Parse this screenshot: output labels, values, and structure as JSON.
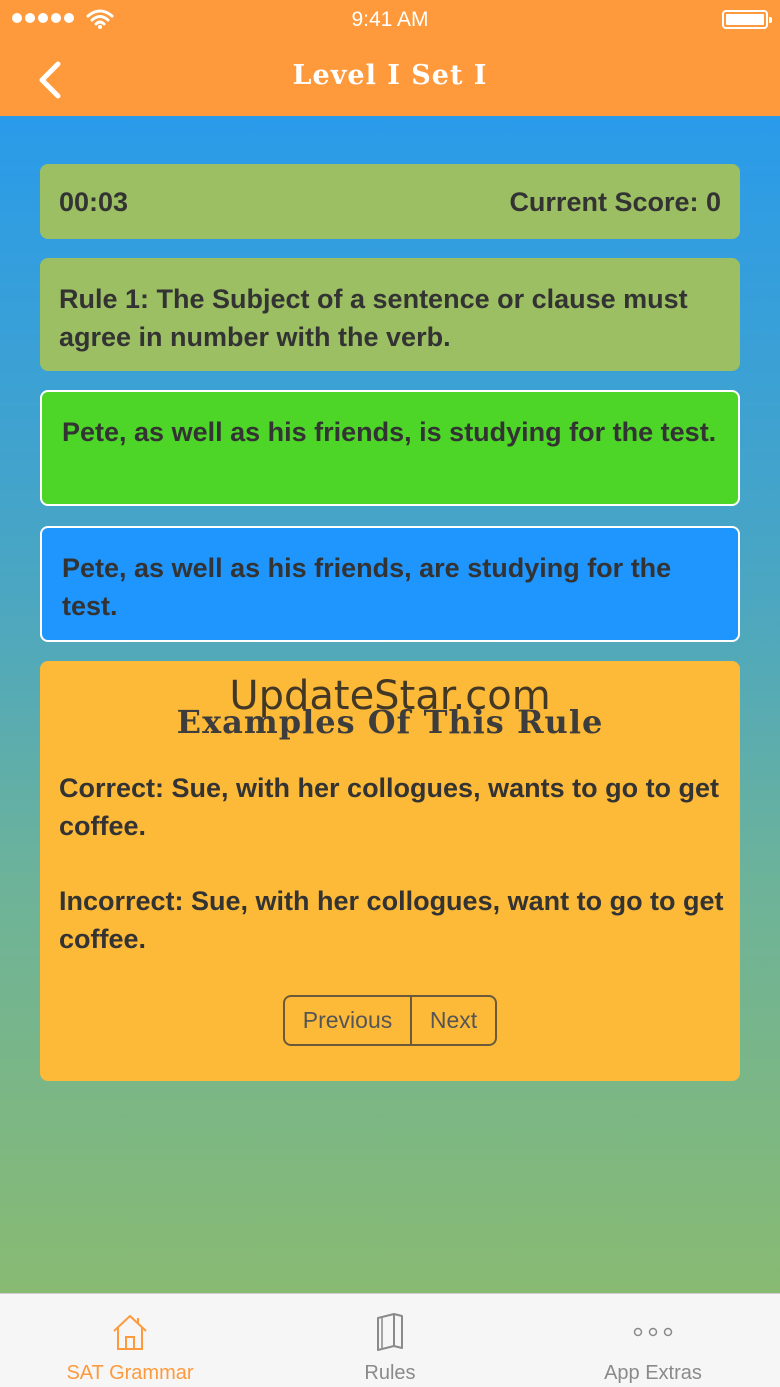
{
  "status_bar": {
    "time": "9:41 AM"
  },
  "header": {
    "title": "Level I Set I",
    "back_icon": "chevron-left-icon"
  },
  "quiz": {
    "timer": "00:03",
    "score_label": "Current Score: 0",
    "rule": "Rule 1: The Subject of a sentence or clause must agree in number with the verb.",
    "options": [
      "Pete, as well as his friends, is studying for the test.",
      "Pete, as well as his friends, are studying for the test."
    ]
  },
  "examples": {
    "watermark": "UpdateStar.com",
    "title": "Examples Of This Rule",
    "correct": "Correct: Sue, with her collogues, wants to go to get coffee.",
    "incorrect": "Incorrect: Sue, with her collogues, want to go to get coffee.",
    "previous_label": "Previous",
    "next_label": "Next"
  },
  "tabbar": {
    "items": [
      {
        "label": "SAT Grammar",
        "icon": "home-icon",
        "active": true
      },
      {
        "label": "Rules",
        "icon": "book-icon",
        "active": false
      },
      {
        "label": "App Extras",
        "icon": "more-icon",
        "active": false
      }
    ]
  },
  "colors": {
    "header": "#FE9A3C",
    "card_green_muted": "#9BBF62",
    "option_green": "#4DD528",
    "option_blue": "#1F95FE",
    "examples_card": "#FDBA38"
  }
}
